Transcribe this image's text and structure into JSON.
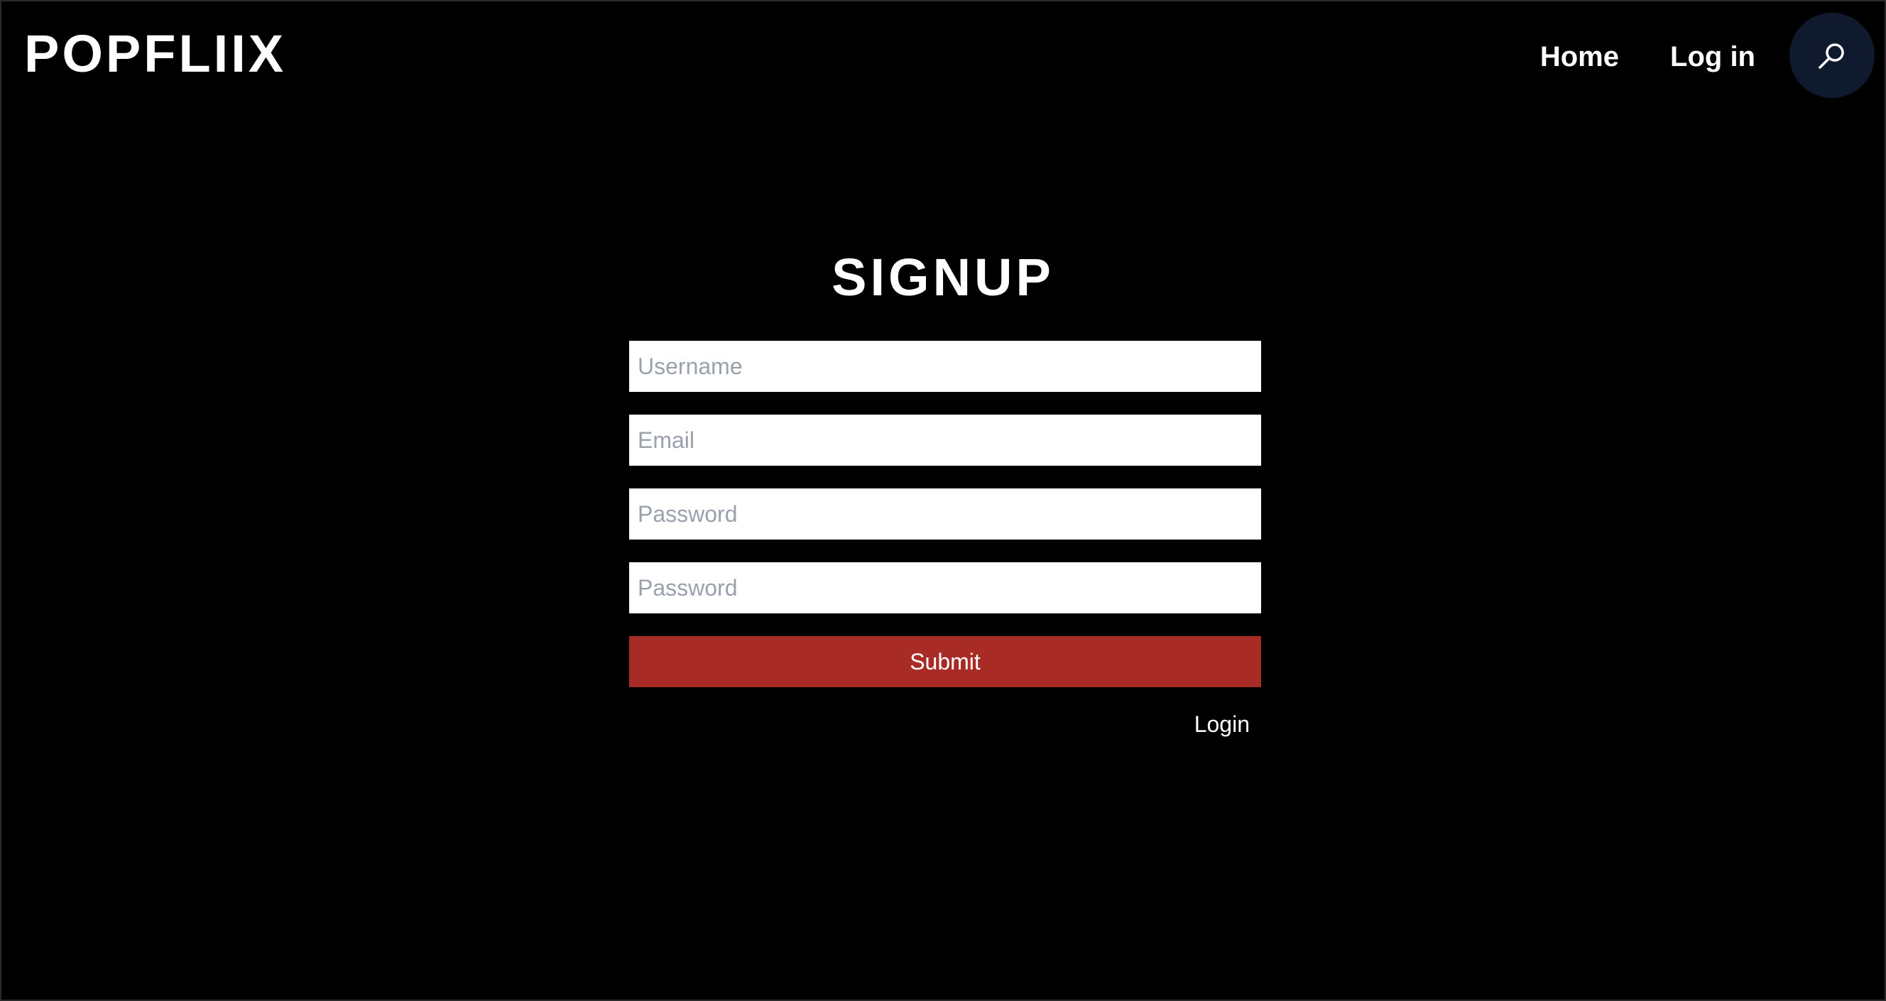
{
  "header": {
    "logo": "POPFLIIX",
    "nav": {
      "home_label": "Home",
      "login_label": "Log in"
    },
    "search_icon": "search-icon"
  },
  "signup": {
    "title": "SIGNUP",
    "fields": {
      "username_placeholder": "Username",
      "email_placeholder": "Email",
      "password_placeholder": "Password",
      "confirm_password_placeholder": "Password"
    },
    "submit_label": "Submit",
    "login_link": "Login"
  },
  "colors": {
    "background": "#000000",
    "submit_button": "#a92b26",
    "search_button": "#101a2e",
    "placeholder": "#9aa1ad"
  }
}
